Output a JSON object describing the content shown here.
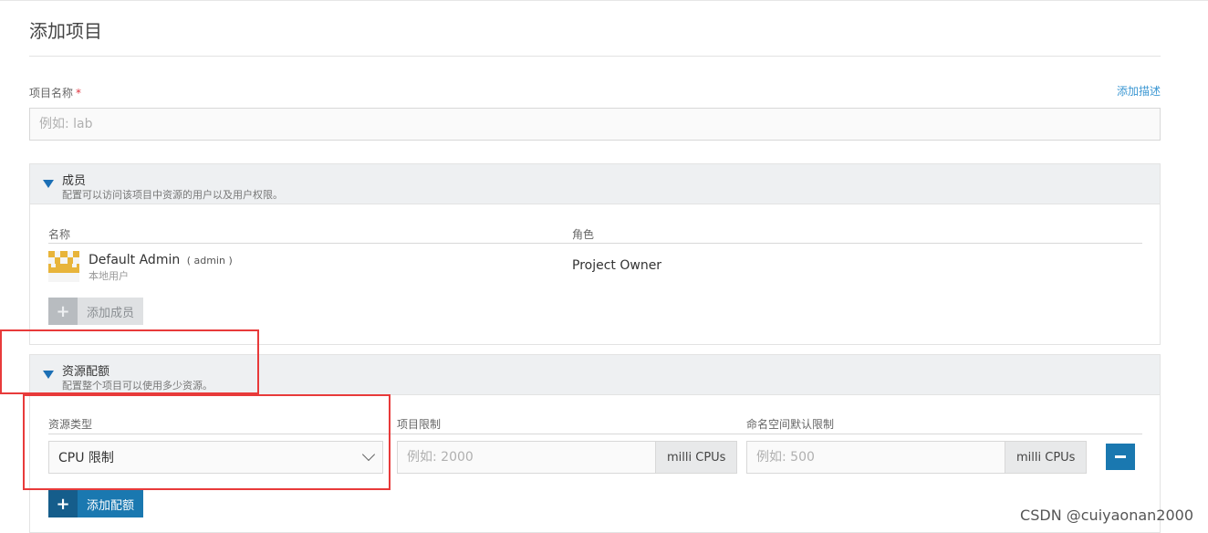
{
  "page": {
    "title": "添加项目",
    "add_description_link": "添加描述"
  },
  "project_name": {
    "label": "项目名称",
    "required_mark": "*",
    "placeholder": "例如: lab"
  },
  "members": {
    "title": "成员",
    "subtitle": "配置可以访问该项目中资源的用户以及用户权限。",
    "columns": [
      "名称",
      "角色"
    ],
    "rows": [
      {
        "display_name": "Default Admin",
        "username": "( admin )",
        "user_type": "本地用户",
        "role": "Project Owner"
      }
    ],
    "add_button": {
      "icon": "+",
      "label": "添加成员"
    }
  },
  "quota": {
    "title": "资源配额",
    "subtitle": "配置整个项目可以使用多少资源。",
    "columns": [
      "资源类型",
      "项目限制",
      "命名空间默认限制"
    ],
    "rows": [
      {
        "resource_type": "CPU 限制",
        "project_limit_placeholder": "例如: 2000",
        "project_limit_unit": "milli CPUs",
        "namespace_limit_placeholder": "例如: 500",
        "namespace_limit_unit": "milli CPUs"
      }
    ],
    "add_button": {
      "icon": "+",
      "label": "添加配额"
    }
  },
  "watermark": "CSDN @cuiyaonan2000",
  "colors": {
    "accent": "#1a78b0",
    "link": "#3d98d3",
    "annotation_red": "#e83a3a",
    "avatar_gold": "#e8b43a"
  },
  "icons": {
    "collapse": "caret-down-icon",
    "dropdown": "chevron-down-icon",
    "remove": "minus-icon",
    "add": "plus-icon"
  }
}
